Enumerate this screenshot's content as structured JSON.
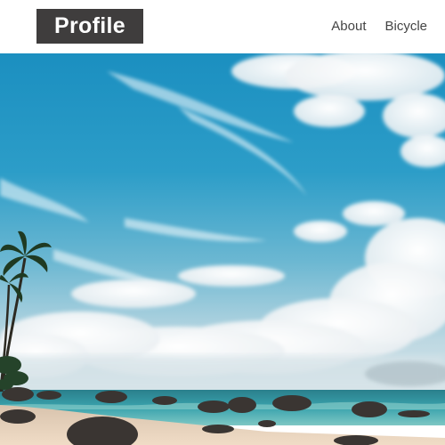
{
  "header": {
    "logo_text": "Profile",
    "nav": [
      {
        "label": "About"
      },
      {
        "label": "Bicycle"
      }
    ]
  },
  "hero": {
    "image_name": "beach-hero-image",
    "colors": {
      "sky_top": "#1b8fc0",
      "sky_mid": "#3aa7c8",
      "horizon": "#c9dfe8",
      "sea": "#2f9aa6",
      "sand": "#e8d3bd"
    }
  },
  "colors": {
    "logo_bg": "#3f3d3d",
    "nav_text": "#444444"
  }
}
